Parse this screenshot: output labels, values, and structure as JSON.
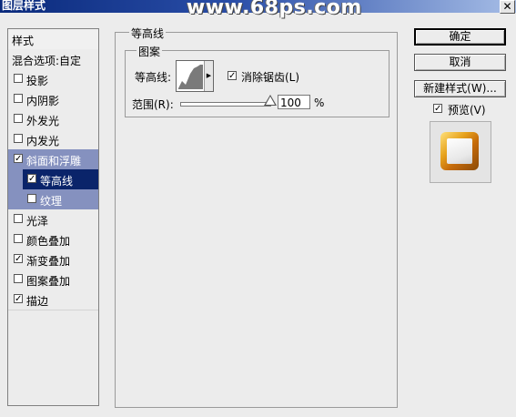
{
  "window": {
    "title": "图层样式",
    "watermark": "www.68ps.com",
    "close_glyph": "✕"
  },
  "styles_panel": {
    "header": "样式",
    "items": [
      {
        "label": "混合选项:自定",
        "checkbox": false,
        "checked": false
      },
      {
        "label": "投影",
        "checkbox": true,
        "checked": false
      },
      {
        "label": "内阴影",
        "checkbox": true,
        "checked": false
      },
      {
        "label": "外发光",
        "checkbox": true,
        "checked": false
      },
      {
        "label": "内发光",
        "checkbox": true,
        "checked": false
      },
      {
        "label": "斜面和浮雕",
        "checkbox": true,
        "checked": true
      },
      {
        "label": "等高线",
        "checkbox": true,
        "checked": true
      },
      {
        "label": "纹理",
        "checkbox": true,
        "checked": false
      },
      {
        "label": "光泽",
        "checkbox": true,
        "checked": false
      },
      {
        "label": "颜色叠加",
        "checkbox": true,
        "checked": false
      },
      {
        "label": "渐变叠加",
        "checkbox": true,
        "checked": true
      },
      {
        "label": "图案叠加",
        "checkbox": true,
        "checked": false
      },
      {
        "label": "描边",
        "checkbox": true,
        "checked": true
      }
    ]
  },
  "contour_section": {
    "group_title": "等高线",
    "subgroup_title": "图案",
    "contour_label": "等高线:",
    "antialias_label": "消除锯齿(L)",
    "antialias_checked": true,
    "range_label": "范围(R):",
    "range_value": "100",
    "range_unit": "%",
    "range_level_percent": 100
  },
  "buttons": {
    "ok": "确定",
    "cancel": "取消",
    "new_style": "新建样式(W)...",
    "preview_label": "预览(V)",
    "preview_checked": true
  },
  "icons": {
    "checkbox_check": "✓",
    "dropdown_arrow": "▶"
  },
  "colors": {
    "title_bar_start": "#0a2a7c",
    "selected_item": "#0a246a",
    "selected_parent": "#8591bf",
    "preview_gold": "#e6a21c"
  }
}
